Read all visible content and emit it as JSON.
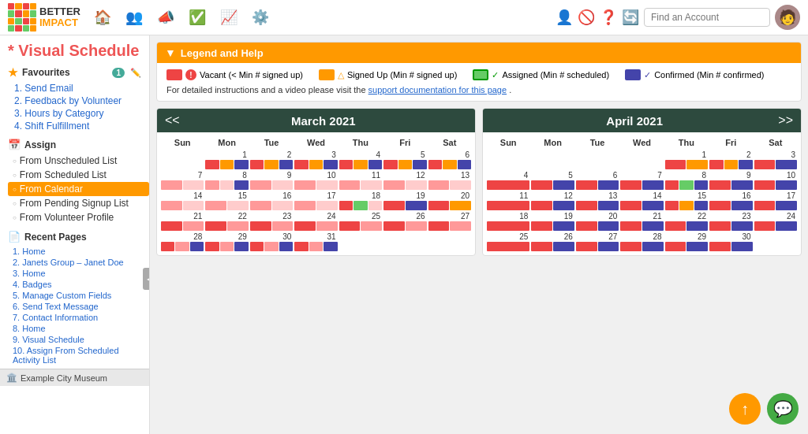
{
  "app": {
    "name": "Better Impact",
    "title": "Visual Schedule"
  },
  "topNav": {
    "searchPlaceholder": "Find an Account",
    "icons": [
      "home",
      "people",
      "megaphone",
      "calendar-check",
      "chart",
      "gear"
    ]
  },
  "sidebar": {
    "title": "* Visual Schedule",
    "favourites": {
      "label": "Favourites",
      "badge": "1",
      "items": [
        "1. Send Email",
        "2. Feedback by Volunteer",
        "3. Hours by Category",
        "4. Shift Fulfillment"
      ]
    },
    "assign": {
      "label": "Assign",
      "items": [
        {
          "label": "From Unscheduled List",
          "active": false
        },
        {
          "label": "From Scheduled List",
          "active": false
        },
        {
          "label": "From Calendar",
          "active": true
        },
        {
          "label": "From Pending Signup List",
          "active": false
        },
        {
          "label": "From Volunteer Profile",
          "active": false
        }
      ]
    },
    "recentPages": {
      "label": "Recent Pages",
      "items": [
        "1. Home",
        "2. Janets Group – Janet Doe",
        "3. Home",
        "4. Badges",
        "5. Manage Custom Fields",
        "6. Send Text Message",
        "7. Contact Information",
        "8. Home",
        "9. Visual Schedule",
        "10. Assign From Scheduled Activity List"
      ]
    },
    "orgName": "Example City Museum"
  },
  "legend": {
    "header": "Legend and Help",
    "items": [
      {
        "color": "#e44",
        "icon": "!",
        "label": "Vacant (< Min # signed up)"
      },
      {
        "color": "#f90",
        "icon": "△",
        "label": "Signed Up (Min # signed up)"
      },
      {
        "color": "#6c6",
        "icon": "✓",
        "label": "Assigned (Min # scheduled)"
      },
      {
        "color": "#44a",
        "icon": "✓",
        "label": "Confirmed (Min # confirmed)"
      }
    ],
    "note": "For detailed instructions and a video please visit the",
    "noteLink": "support documentation for this page",
    "noteSuffix": "."
  },
  "calendars": [
    {
      "month": "March 2021",
      "weekdays": [
        "Sun",
        "Mon",
        "Tue",
        "Wed",
        "Thu",
        "Fri",
        "Sat"
      ],
      "weeks": [
        [
          null,
          1,
          2,
          3,
          4,
          5,
          6
        ],
        [
          7,
          8,
          9,
          10,
          11,
          12,
          13
        ],
        [
          14,
          15,
          16,
          17,
          18,
          19,
          20
        ],
        [
          21,
          22,
          23,
          24,
          25,
          26,
          27
        ],
        [
          28,
          29,
          30,
          31,
          null,
          null,
          null
        ]
      ],
      "dayColors": {
        "1": [
          "#e44",
          "#f90",
          "#44a"
        ],
        "2": [
          "#e44",
          "#f90",
          "#44a"
        ],
        "3": [
          "#e44",
          "#f90",
          "#44a"
        ],
        "4": [
          "#e44",
          "#f90",
          "#44a"
        ],
        "5": [
          "#e44",
          "#f90",
          "#44a"
        ],
        "6": [
          "#e44",
          "#f90",
          "#44a"
        ],
        "7": [
          "#f99",
          "#fcc"
        ],
        "8": [
          "#f99",
          "#fcc",
          "#44a"
        ],
        "9": [
          "#f99",
          "#fcc"
        ],
        "10": [
          "#f99",
          "#fcc"
        ],
        "11": [
          "#f99",
          "#fcc"
        ],
        "12": [
          "#f99",
          "#fcc"
        ],
        "13": [
          "#f99",
          "#fcc"
        ],
        "14": [
          "#f99",
          "#fcc"
        ],
        "15": [
          "#f99",
          "#fcc"
        ],
        "16": [
          "#f99",
          "#fcc"
        ],
        "17": [
          "#f99",
          "#fcc"
        ],
        "18": [
          "#e44",
          "#6c6",
          "#fcc"
        ],
        "19": [
          "#e44",
          "#44a"
        ],
        "20": [
          "#e44",
          "#f90"
        ],
        "21": [
          "#e44",
          "#f99"
        ],
        "22": [
          "#e44",
          "#f99"
        ],
        "23": [
          "#e44",
          "#f99"
        ],
        "24": [
          "#e44",
          "#f99"
        ],
        "25": [
          "#e44",
          "#f99"
        ],
        "26": [
          "#e44",
          "#f99"
        ],
        "27": [
          "#e44",
          "#f99"
        ],
        "28": [
          "#e44",
          "#f99",
          "#44a"
        ],
        "29": [
          "#e44",
          "#f99",
          "#44a"
        ],
        "30": [
          "#e44",
          "#f99",
          "#44a"
        ],
        "31": [
          "#e44",
          "#f99",
          "#44a"
        ]
      }
    },
    {
      "month": "April 2021",
      "weekdays": [
        "Sun",
        "Mon",
        "Tue",
        "Wed",
        "Thu",
        "Fri",
        "Sat"
      ],
      "weeks": [
        [
          null,
          null,
          null,
          null,
          1,
          2,
          3
        ],
        [
          4,
          5,
          6,
          7,
          8,
          9,
          10
        ],
        [
          11,
          12,
          13,
          14,
          15,
          16,
          17
        ],
        [
          18,
          19,
          20,
          21,
          22,
          23,
          24
        ],
        [
          25,
          26,
          27,
          28,
          29,
          30,
          null
        ]
      ],
      "dayColors": {
        "1": [
          "#e44",
          "#f90"
        ],
        "2": [
          "#e44",
          "#f90",
          "#44a"
        ],
        "3": [
          "#e44",
          "#44a"
        ],
        "4": [
          "#e44"
        ],
        "5": [
          "#e44",
          "#44a"
        ],
        "6": [
          "#e44",
          "#44a"
        ],
        "7": [
          "#e44",
          "#44a"
        ],
        "8": [
          "#e44",
          "#6c6",
          "#44a"
        ],
        "9": [
          "#e44",
          "#44a"
        ],
        "10": [
          "#e44",
          "#44a"
        ],
        "11": [
          "#e44"
        ],
        "12": [
          "#e44",
          "#44a"
        ],
        "13": [
          "#e44",
          "#44a"
        ],
        "14": [
          "#e44",
          "#44a"
        ],
        "15": [
          "#e44",
          "#f90",
          "#44a"
        ],
        "16": [
          "#e44",
          "#44a"
        ],
        "17": [
          "#e44",
          "#44a"
        ],
        "18": [
          "#e44"
        ],
        "19": [
          "#e44",
          "#44a"
        ],
        "20": [
          "#e44",
          "#44a"
        ],
        "21": [
          "#e44",
          "#44a"
        ],
        "22": [
          "#e44",
          "#44a"
        ],
        "23": [
          "#e44",
          "#44a"
        ],
        "24": [
          "#e44",
          "#44a"
        ],
        "25": [
          "#e44"
        ],
        "26": [
          "#e44",
          "#44a"
        ],
        "27": [
          "#e44",
          "#44a"
        ],
        "28": [
          "#e44",
          "#44a"
        ],
        "29": [
          "#e44",
          "#44a"
        ],
        "30": [
          "#e44",
          "#44a"
        ]
      }
    }
  ],
  "buttons": {
    "scrollUp": "↑",
    "chat": "💬"
  }
}
